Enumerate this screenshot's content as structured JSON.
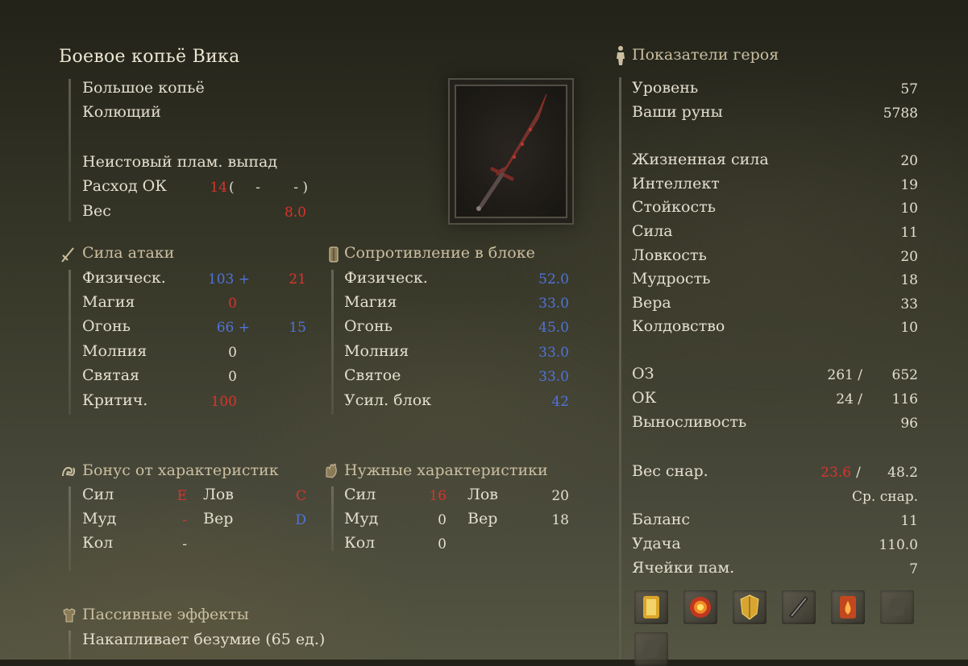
{
  "weapon": {
    "name": "Боевое копьё Вика",
    "type": "Большое копьё",
    "damage_type": "Колющий",
    "skill": "Неистовый плам. выпад",
    "fp_label": "Расход ОК",
    "fp_value": "14",
    "fp_open": "(",
    "fp_dash1": "-",
    "fp_dash2": "- )",
    "weight_label": "Вес",
    "weight_value": "8.0"
  },
  "attack": {
    "title": "Сила атаки",
    "rows": [
      {
        "label": "Физическ.",
        "base": "103 +",
        "bonus": "21"
      },
      {
        "label": "Магия",
        "base": "0",
        "bonus": ""
      },
      {
        "label": "Огонь",
        "base": "66 +",
        "bonus": "15"
      },
      {
        "label": "Молния",
        "base": "0",
        "bonus": ""
      },
      {
        "label": "Святая",
        "base": "0",
        "bonus": ""
      },
      {
        "label": "Критич.",
        "base": "100",
        "bonus": ""
      }
    ]
  },
  "guard": {
    "title": "Сопротивление в блоке",
    "rows": [
      {
        "label": "Физическ.",
        "value": "52.0"
      },
      {
        "label": "Магия",
        "value": "33.0"
      },
      {
        "label": "Огонь",
        "value": "45.0"
      },
      {
        "label": "Молния",
        "value": "33.0"
      },
      {
        "label": "Святое",
        "value": "33.0"
      },
      {
        "label": "Усил. блок",
        "value": "42"
      }
    ]
  },
  "scaling": {
    "title": "Бонус от характеристик",
    "str_label": "Сил",
    "str_value": "E",
    "dex_label": "Лов",
    "dex_value": "C",
    "int_label": "Муд",
    "int_value": "-",
    "fai_label": "Вер",
    "fai_value": "D",
    "arc_label": "Кол",
    "arc_value": "-"
  },
  "requirements": {
    "title": "Нужные характеристики",
    "str_label": "Сил",
    "str_value": "16",
    "dex_label": "Лов",
    "dex_value": "20",
    "int_label": "Муд",
    "int_value": "0",
    "fai_label": "Вер",
    "fai_value": "18",
    "arc_label": "Кол",
    "arc_value": "0"
  },
  "passive": {
    "title": "Пассивные эффекты",
    "text": "Накапливает безумие (65 ед.)"
  },
  "hero": {
    "title": "Показатели героя",
    "level_label": "Уровень",
    "level_value": "57",
    "runes_label": "Ваши руны",
    "runes_value": "5788",
    "attributes": [
      {
        "label": "Жизненная сила",
        "value": "20"
      },
      {
        "label": "Интеллект",
        "value": "19"
      },
      {
        "label": "Стойкость",
        "value": "10"
      },
      {
        "label": "Сила",
        "value": "11"
      },
      {
        "label": "Ловкость",
        "value": "20"
      },
      {
        "label": "Мудрость",
        "value": "18"
      },
      {
        "label": "Вера",
        "value": "33"
      },
      {
        "label": "Колдовство",
        "value": "10"
      }
    ],
    "hp_label": "ОЗ",
    "hp_current": "261 /",
    "hp_max": "652",
    "fp_label": "ОК",
    "fp_current": "24 /",
    "fp_max": "116",
    "stamina_label": "Выносливость",
    "stamina_value": "96",
    "equip_label": "Вес снар.",
    "equip_current": "23.6",
    "equip_slash": "/",
    "equip_max": "48.2",
    "equip_class": "Ср. снар.",
    "poise_label": "Баланс",
    "poise_value": "11",
    "discovery_label": "Удача",
    "discovery_value": "110.0",
    "slots_label": "Ячейки пам.",
    "slots_value": "7"
  },
  "spell_slots": [
    {
      "icon": "golden-vow-scroll-icon",
      "filled": true
    },
    {
      "icon": "fire-explosion-icon",
      "filled": true
    },
    {
      "icon": "golden-shield-icon",
      "filled": true
    },
    {
      "icon": "black-blade-icon",
      "filled": true
    },
    {
      "icon": "flame-scroll-icon",
      "filled": true
    },
    {
      "icon": "empty-slot-icon",
      "filled": false
    },
    {
      "icon": "empty-slot-icon",
      "filled": false
    }
  ],
  "colors": {
    "text": "#e4dfcf",
    "red": "#d8342b",
    "blue": "#4f73d8",
    "section": "#cbbfa1"
  }
}
